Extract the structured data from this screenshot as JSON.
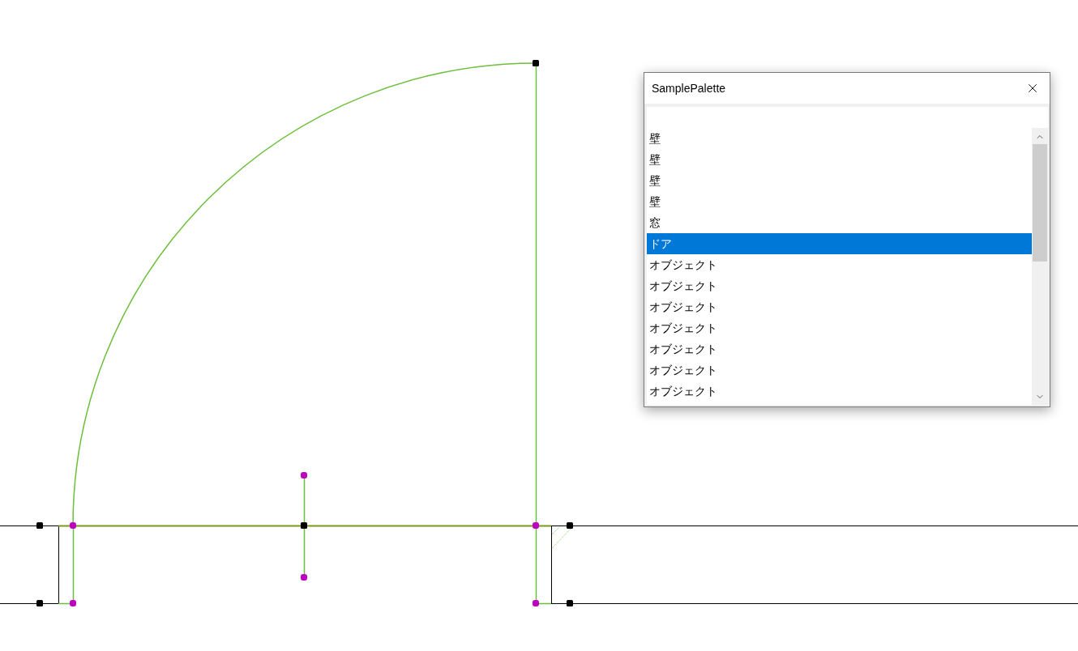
{
  "palette": {
    "title": "SamplePalette",
    "items": [
      {
        "label": "壁",
        "selected": false
      },
      {
        "label": "壁",
        "selected": false
      },
      {
        "label": "壁",
        "selected": false
      },
      {
        "label": "壁",
        "selected": false
      },
      {
        "label": "窓",
        "selected": false
      },
      {
        "label": "ドア",
        "selected": true
      },
      {
        "label": "オブジェクト",
        "selected": false
      },
      {
        "label": "オブジェクト",
        "selected": false
      },
      {
        "label": "オブジェクト",
        "selected": false
      },
      {
        "label": "オブジェクト",
        "selected": false
      },
      {
        "label": "オブジェクト",
        "selected": false
      },
      {
        "label": "オブジェクト",
        "selected": false
      },
      {
        "label": "オブジェクト",
        "selected": false
      }
    ]
  }
}
